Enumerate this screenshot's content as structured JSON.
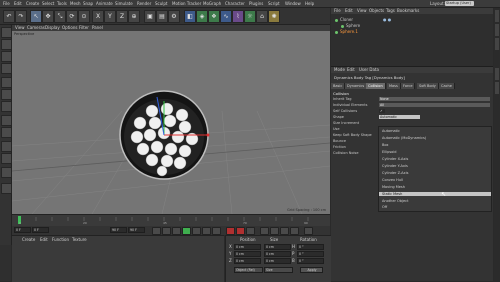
{
  "menubar": {
    "items": [
      "File",
      "Edit",
      "Create",
      "Select",
      "Tools",
      "Mesh",
      "Snap",
      "Animate",
      "Simulate",
      "Render",
      "Sculpt",
      "Motion Tracker",
      "MoGraph",
      "Character",
      "Plugins",
      "Script",
      "Window",
      "Help"
    ],
    "layout_label": "Layout:",
    "layout_value": "Startup (User)"
  },
  "viewport": {
    "menu": [
      "View",
      "Cameras",
      "Display",
      "Options",
      "Filter",
      "Panel"
    ],
    "label": "Perspective",
    "grid_spacing": "Grid Spacing : 100 cm"
  },
  "timeline": {
    "ticks": [
      "0",
      "5",
      "10",
      "15",
      "20",
      "25",
      "30",
      "35",
      "40",
      "45",
      "50",
      "55",
      "60",
      "65",
      "70",
      "75",
      "80",
      "85",
      "90"
    ],
    "frame_start": "0 F",
    "frame_end": "90 F",
    "frame_end2": "90 F",
    "frame_cur": "0 F"
  },
  "materials": {
    "menu": [
      "Create",
      "Edit",
      "Function",
      "Texture"
    ]
  },
  "coords": {
    "headers": [
      "Position",
      "Size",
      "Rotation"
    ],
    "rows": [
      {
        "axis": "X",
        "pos": "0 cm",
        "size": "0 cm",
        "rot_label": "H",
        "rot": "0 °"
      },
      {
        "axis": "Y",
        "pos": "0 cm",
        "size": "0 cm",
        "rot_label": "P",
        "rot": "0 °"
      },
      {
        "axis": "Z",
        "pos": "0 cm",
        "size": "0 cm",
        "rot_label": "B",
        "rot": "0 °"
      }
    ],
    "mode1": "Object (Rel)",
    "mode2": "Size",
    "apply": "Apply"
  },
  "objects": {
    "menu": [
      "File",
      "Edit",
      "View",
      "Objects",
      "Tags",
      "Bookmarks"
    ],
    "items": [
      {
        "name": "Cloner",
        "color": "#6cc46c"
      },
      {
        "name": "Sphere",
        "color": "#6cc46c"
      },
      {
        "name": "Sphere.1",
        "color": "#6cc46c"
      }
    ]
  },
  "attributes": {
    "menu": [
      "Mode",
      "Edit",
      "User Data"
    ],
    "title": "Dynamics Body Tag [Dynamics Body]",
    "tabs": [
      "Basic",
      "Dynamics",
      "Collision",
      "Mass",
      "Force",
      "Soft Body",
      "Cache"
    ],
    "active_tab": "Collision",
    "section": "Collision",
    "props": [
      {
        "label": "Inherit Tag",
        "value": "None"
      },
      {
        "label": "Individual Elements",
        "value": "All"
      },
      {
        "label": "Self Collisions",
        "value": "✓"
      },
      {
        "label": "Shape",
        "value": "Automatic"
      },
      {
        "label": "Size Increment",
        "value": ""
      },
      {
        "label": "Use",
        "value": ""
      },
      {
        "label": "Keep Soft Body Shape",
        "value": ""
      },
      {
        "label": "Bounce",
        "value": ""
      },
      {
        "label": "Friction",
        "value": ""
      },
      {
        "label": "Collision Noise",
        "value": ""
      }
    ],
    "dropdown": [
      "Automatic",
      "Automatic (MoDynamics)",
      "Box",
      "Ellipsoid",
      "Cylinder X-Axis",
      "Cylinder Y-Axis",
      "Cylinder Z-Axis",
      "Convex Hull",
      "Moving Mesh",
      "Static Mesh",
      "Another Object",
      "Off"
    ],
    "dropdown_selected": "Static Mesh"
  }
}
